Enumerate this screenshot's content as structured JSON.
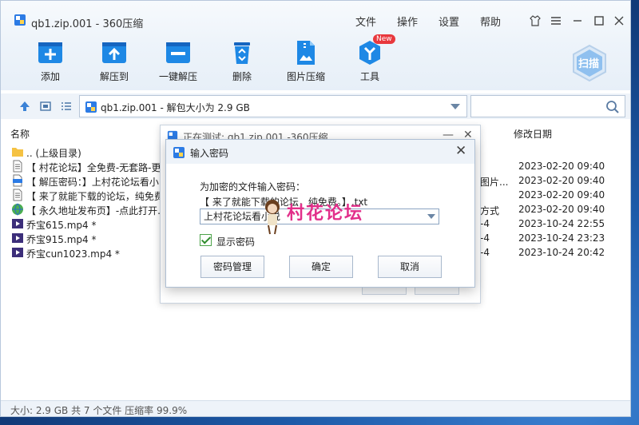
{
  "window": {
    "title": "qb1.zip.001 - 360压缩",
    "menus": [
      "文件",
      "操作",
      "设置",
      "帮助"
    ]
  },
  "toolbar": {
    "items": [
      {
        "label": "添加",
        "icon": "add-box-icon"
      },
      {
        "label": "解压到",
        "icon": "extract-to-icon"
      },
      {
        "label": "一键解压",
        "icon": "one-click-extract-icon"
      },
      {
        "label": "删除",
        "icon": "recycle-bin-icon"
      },
      {
        "label": "图片压缩",
        "icon": "image-compress-icon"
      },
      {
        "label": "工具",
        "icon": "tools-icon"
      }
    ],
    "new_badge": "New",
    "scan_label": "扫描"
  },
  "address": {
    "path": "qb1.zip.001 - 解包大小为 2.9 GB"
  },
  "list": {
    "col_name": "名称",
    "col_date": "修改日期",
    "rows": [
      {
        "name": ".. (上级目录)",
        "icon": "folder-icon",
        "extra": "",
        "date": ""
      },
      {
        "name": "【 村花论坛】全免费-无套路-更",
        "icon": "text-file-icon",
        "extra": "",
        "date": "2023-02-20 09:40"
      },
      {
        "name": "【 解压密码：】上村花论坛看小",
        "icon": "jpg-file-icon",
        "extra": "图片...",
        "date": "2023-02-20 09:40"
      },
      {
        "name": "【 来了就能下载的论坛，纯免费",
        "icon": "text-file-icon",
        "extra": "",
        "date": "2023-02-20 09:40"
      },
      {
        "name": "【 永久地址发布页】-点此打开.",
        "icon": "globe-icon",
        "extra": "方式",
        "date": "2023-02-20 09:40"
      },
      {
        "name": "乔宝615.mp4 *",
        "icon": "mp4-file-icon",
        "extra": "-4",
        "date": "2023-10-24 22:55"
      },
      {
        "name": "乔宝915.mp4 *",
        "icon": "mp4-file-icon",
        "extra": "-4",
        "date": "2023-10-24 23:23"
      },
      {
        "name": "乔宝cun1023.mp4 *",
        "icon": "mp4-file-icon",
        "extra": "-4",
        "date": "2023-10-24 20:42"
      }
    ]
  },
  "status": {
    "text": "大小: 2.9 GB 共 7 个文件 压缩率 99.9%"
  },
  "test_dialog": {
    "title": "正在测试: qb1.zip.001 -360压缩"
  },
  "password_dialog": {
    "title": "输入密码",
    "prompt": "为加密的文件输入密码：",
    "file": "【 来了就能下载的论坛，纯免费。】.txt",
    "value": "上村花论坛看小说",
    "show_password": "显示密码",
    "btn_manage": "密码管理",
    "btn_ok": "确定",
    "btn_cancel": "取消"
  },
  "watermark": {
    "text": "村花论坛"
  },
  "colors": {
    "accent": "#1e88e5",
    "watermark": "#e22f8a",
    "new_badge": "#e8383d"
  }
}
